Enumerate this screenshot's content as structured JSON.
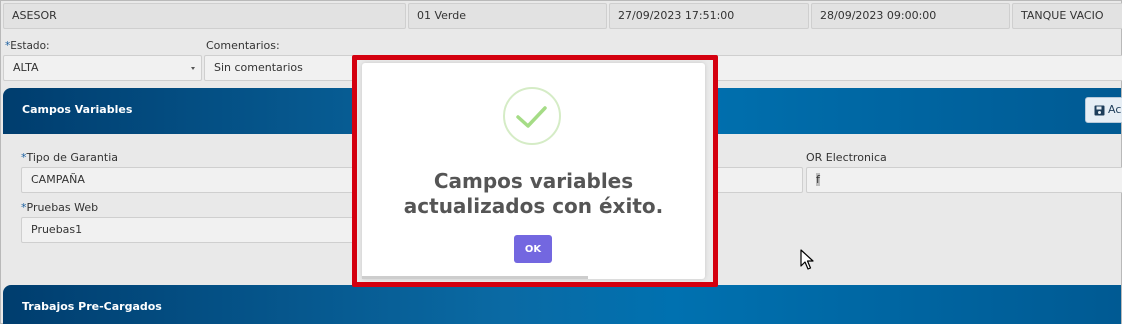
{
  "top_row": {
    "role": "ASESOR",
    "status_color": "01 Verde",
    "date_start": "27/09/2023 17:51:00",
    "date_end": "28/09/2023 09:00:00",
    "fuel": "TANQUE VACIO"
  },
  "estado": {
    "required_mark": "*",
    "label": "Estado:",
    "value": "ALTA"
  },
  "comentarios": {
    "label": "Comentarios:",
    "value": "Sin comentarios"
  },
  "campos_variables": {
    "title": "Campos Variables",
    "save_label": "Ac",
    "tipo_garantia": {
      "required_mark": "*",
      "label": "Tipo de Garantia",
      "value": "CAMPAÑA"
    },
    "or_electronica": {
      "label": "OR Electronica",
      "value": "f"
    },
    "pruebas_web": {
      "required_mark": "*",
      "label": "Pruebas Web",
      "value": "Pruebas1"
    }
  },
  "trabajos": {
    "title": "Trabajos Pre-Cargados"
  },
  "modal": {
    "icon": "success-check-icon",
    "message": "Campos variables actualizados con éxito.",
    "ok_label": "OK",
    "accent_color": "#7367e0",
    "check_color": "#a5dc86"
  },
  "colors": {
    "header_bar": "#0a6aa4",
    "highlight_border": "#d4000f"
  }
}
